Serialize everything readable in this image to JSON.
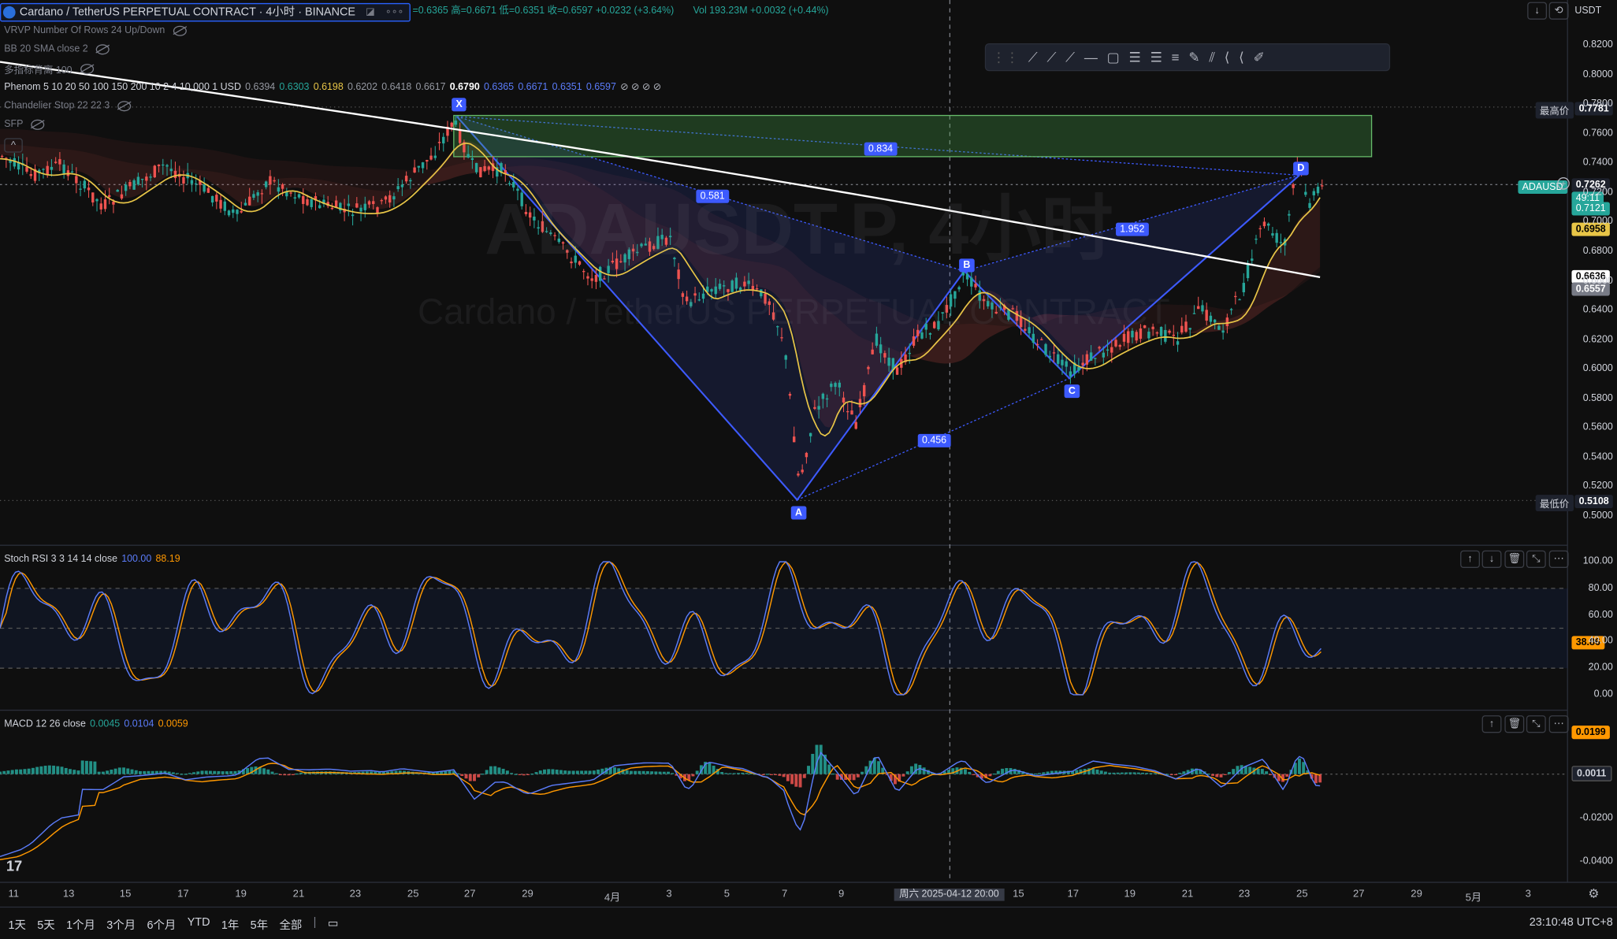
{
  "header": {
    "symbol_title": "Cardano / TetherUS PERPETUAL CONTRACT · 4小时 · BINANCE",
    "ohlc": "=0.6365 高=0.6671 低=0.6351 收=0.6597 +0.0232 (+3.64%)",
    "vol": "Vol 193.23M +0.0032 (+0.44%)",
    "more": "∘∘∘",
    "currency": "USDT"
  },
  "indicators": [
    {
      "name": "VRVP Number Of Rows 24 Up/Down"
    },
    {
      "name": "BB 20 SMA close 2"
    },
    {
      "name": "多指标背离 100"
    },
    {
      "name": "Phenom 5 10 20 50 100 150 200 10 2 4 10,000 1 USD",
      "values": [
        "0.6394",
        "0.6303",
        "0.6198",
        "0.6202",
        "0.6418",
        "0.6617",
        "0.6790",
        "0.6365",
        "0.6671",
        "0.6351",
        "0.6597"
      ]
    },
    {
      "name": "Chandelier Stop 22 22 3"
    },
    {
      "name": "SFP"
    }
  ],
  "watermark": {
    "big": "ADAUSDT.P, 4小时",
    "small": "Cardano / TetherUS PERPETUAL CONTRACT"
  },
  "harmonic": {
    "points": [
      "X",
      "A",
      "B",
      "C",
      "D"
    ],
    "ratios": [
      "0.834",
      "0.581",
      "1.952",
      "0.456"
    ]
  },
  "price_axis": {
    "ticks": [
      "0.8200",
      "0.8000",
      "0.7800",
      "0.7600",
      "0.7400",
      "0.7200",
      "0.7000",
      "0.6800",
      "0.6600",
      "0.6400",
      "0.6200",
      "0.6000",
      "0.5800",
      "0.5600",
      "0.5400",
      "0.5200",
      "0.5000"
    ],
    "high_label": "最高价",
    "high_value": "0.7781",
    "low_label": "最低价",
    "low_value": "0.5108",
    "current_symbol": "ADAUSD",
    "current_value": "0.7262",
    "countdown": "49:11",
    "current_alt": "0.7121",
    "yellow_value": "0.6958",
    "white_value": "0.6636",
    "grey_value": "0.6557"
  },
  "stoch_rsi": {
    "name": "Stoch RSI 3 3 14 14 close",
    "k": "100.00",
    "d": "88.19",
    "ticks": [
      "100.00",
      "80.00",
      "60.00",
      "40.00",
      "20.00",
      "0.00"
    ],
    "current": "38.86"
  },
  "macd": {
    "name": "MACD 12 26 close",
    "hist": "0.0045",
    "macd": "0.0104",
    "signal": "0.0059",
    "ticks": [
      "-0.0200",
      "-0.0400"
    ],
    "value1": "0.0199",
    "value2": "0.0011"
  },
  "time_axis": {
    "labels": [
      "11",
      "13",
      "15",
      "17",
      "19",
      "21",
      "23",
      "25",
      "27",
      "29",
      "4月",
      "3",
      "5",
      "7",
      "9",
      "15",
      "17",
      "19",
      "21",
      "23",
      "25",
      "27",
      "29",
      "5月",
      "3"
    ],
    "crosshair": "周六 2025-04-12   20:00"
  },
  "bottom_bar": {
    "ranges": [
      "1天",
      "5天",
      "1个月",
      "3个月",
      "6个月",
      "YTD",
      "1年",
      "5年",
      "全部"
    ],
    "clock": "23:10:48 UTC+8"
  },
  "colors": {
    "up": "#26a69a",
    "down": "#ef5350",
    "harmonic": "#3d5afe",
    "rect": "#4caf50"
  }
}
